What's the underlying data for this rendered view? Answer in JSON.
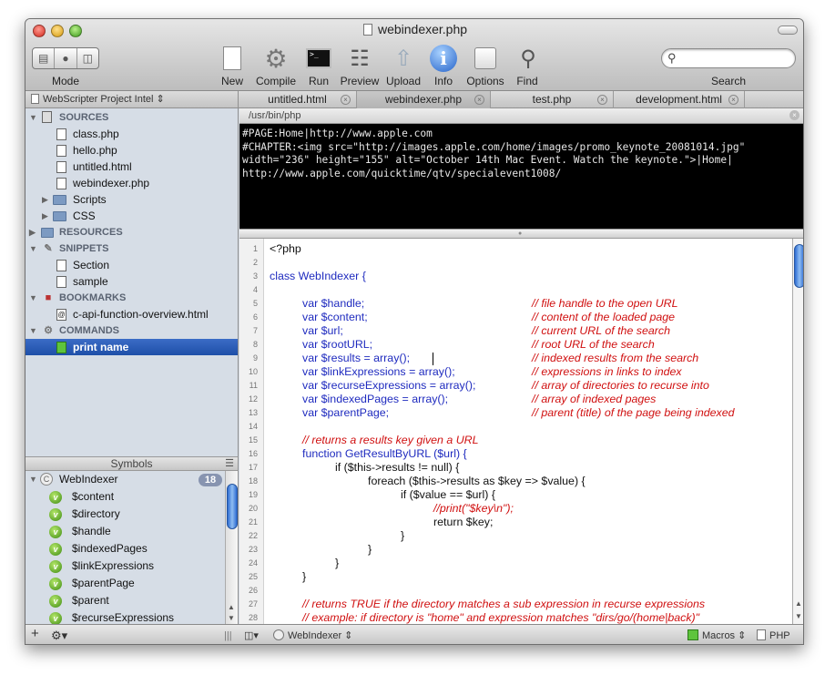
{
  "window": {
    "title": "webindexer.php"
  },
  "toolbar": {
    "mode_label": "Mode",
    "new_label": "New",
    "compile_label": "Compile",
    "run_label": "Run",
    "preview_label": "Preview",
    "upload_label": "Upload",
    "info_label": "Info",
    "options_label": "Options",
    "find_label": "Find",
    "search_label": "Search",
    "search_value": ""
  },
  "project": {
    "name": "WebScripter Project Intel"
  },
  "tabs": [
    {
      "label": "untitled.html"
    },
    {
      "label": "webindexer.php"
    },
    {
      "label": "test.php"
    },
    {
      "label": "development.html"
    }
  ],
  "sidebar": {
    "sources": "SOURCES",
    "files": [
      "class.php",
      "hello.php",
      "untitled.html",
      "webindexer.php"
    ],
    "folders": [
      "Scripts",
      "CSS"
    ],
    "resources": "RESOURCES",
    "snippets": "SNIPPETS",
    "snippet_items": [
      "Section",
      "sample"
    ],
    "bookmarks": "BOOKMARKS",
    "bookmark_items": [
      "c-api-function-overview.html"
    ],
    "commands": "COMMANDS",
    "command_items": [
      "print name"
    ]
  },
  "symbols": {
    "header": "Symbols",
    "class_name": "WebIndexer",
    "count": "18",
    "items": [
      "$content",
      "$directory",
      "$handle",
      "$indexedPages",
      "$linkExpressions",
      "$parentPage",
      "$parent",
      "$recurseExpressions"
    ]
  },
  "path": "/usr/bin/php",
  "console": {
    "lines": [
      "#PAGE:Home|http://www.apple.com",
      "#CHAPTER:<img src=\"http://images.apple.com/home/images/promo_keynote_20081014.jpg\"",
      "width=\"236\" height=\"155\" alt=\"October 14th Mac Event. Watch the keynote.\">|Home|",
      "http://www.apple.com/quicktime/qtv/specialevent1008/"
    ]
  },
  "code": {
    "line_numbers": [
      "1",
      "2",
      "3",
      "4",
      "5",
      "6",
      "7",
      "8",
      "9",
      "10",
      "11",
      "12",
      "13",
      "14",
      "15",
      "16",
      "17",
      "18",
      "19",
      "20",
      "21",
      "22",
      "23",
      "24",
      "25",
      "26",
      "27",
      "28"
    ],
    "lines": [
      "<?php",
      "",
      "class WebIndexer {",
      "",
      "var $handle;",
      "var $content;",
      "var $url;",
      "var $rootURL;",
      "var $results = array();",
      "var $linkExpressions = array();",
      "var $recurseExpressions = array();",
      "var $indexedPages = array();",
      "var $parentPage;",
      "",
      "// returns a results key given a URL",
      "function GetResultByURL ($url) {",
      "if ($this->results != null) {",
      "foreach ($this->results as $key => $value) {",
      "if ($value == $url) {",
      "//print(\"$key\\n\");",
      "return $key;",
      "}",
      "}",
      "}",
      "}",
      "",
      "// returns TRUE if the directory matches a sub expression in recurse expressions",
      "// example: if directory is \"home\" and expression matches \"dirs/go/(home|back)\""
    ],
    "comments": [
      "// file handle to the open URL",
      "// content of the loaded page",
      "// current URL of the search",
      "// root URL of the search",
      "// indexed results from the search",
      "// expressions in links to index",
      "// array of directories to recurse into",
      "// array of indexed pages",
      "// parent (title) of the page being indexed"
    ]
  },
  "statusbar": {
    "class_popup": "WebIndexer",
    "macros": "Macros",
    "language": "PHP"
  },
  "colors": {
    "selection": "#2a5bb7",
    "comment": "#d01010",
    "keyword": "#1f2bbf",
    "console_bg": "#000000"
  }
}
